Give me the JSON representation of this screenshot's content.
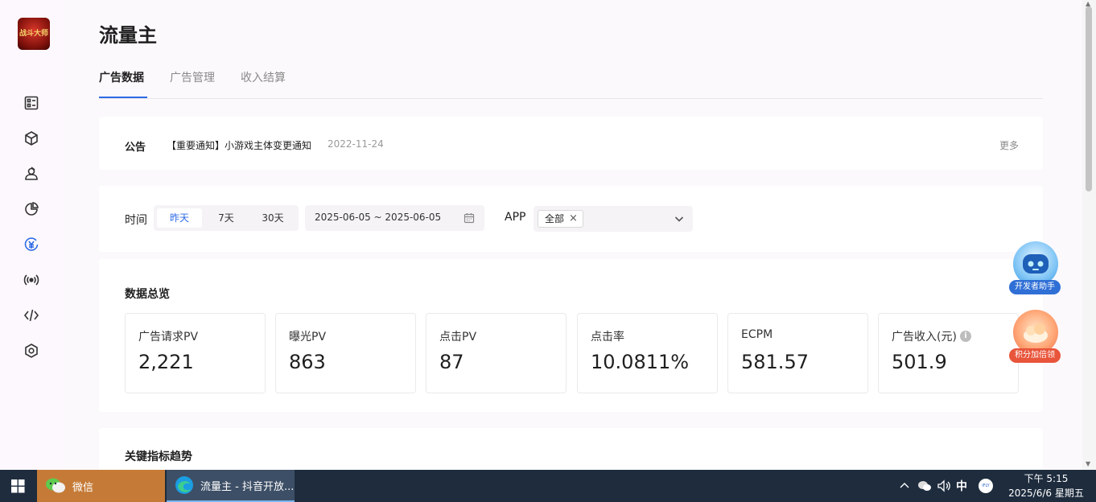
{
  "app": {
    "logo_text": "战斗大师"
  },
  "sidebar": {
    "items": [
      {
        "icon": "dashboard-icon"
      },
      {
        "icon": "cube-icon"
      },
      {
        "icon": "user-group-icon"
      },
      {
        "icon": "pie-chart-icon"
      },
      {
        "icon": "yuan-icon"
      },
      {
        "icon": "broadcast-icon"
      },
      {
        "icon": "code-icon"
      },
      {
        "icon": "settings-hexagon-icon"
      }
    ],
    "active_index": 4
  },
  "header": {
    "title": "流量主",
    "tabs": [
      {
        "label": "广告数据",
        "active": true
      },
      {
        "label": "广告管理",
        "active": false
      },
      {
        "label": "收入结算",
        "active": false
      }
    ]
  },
  "notice": {
    "label": "公告",
    "text": "【重要通知】小游戏主体变更通知",
    "date": "2022-11-24",
    "more": "更多"
  },
  "filter": {
    "time_label": "时间",
    "ranges": [
      "昨天",
      "7天",
      "30天"
    ],
    "active_range": "昨天",
    "date_range": "2025-06-05 ~ 2025-06-05",
    "app_label": "APP",
    "app_tag": "全部",
    "app_tag_close": "×"
  },
  "overview": {
    "title": "数据总览",
    "metrics": [
      {
        "label": "广告请求PV",
        "value": "2,221"
      },
      {
        "label": "曝光PV",
        "value": "863"
      },
      {
        "label": "点击PV",
        "value": "87"
      },
      {
        "label": "点击率",
        "value": "10.0811%"
      },
      {
        "label": "ECPM",
        "value": "581.57"
      },
      {
        "label": "广告收入(元)",
        "value": "501.9",
        "info": "i"
      }
    ]
  },
  "trend": {
    "title": "关键指标趋势"
  },
  "floating": {
    "assistant_label": "开发者助手",
    "points_label": "积分加倍领"
  },
  "taskbar": {
    "apps": [
      {
        "label": "微信"
      },
      {
        "label": "流量主 - 抖音开放..."
      }
    ],
    "tray": {
      "ime": "中",
      "ime_badge": "iFLY"
    },
    "clock": {
      "time": "下午 5:15",
      "date": "2025/6/6 星期五"
    }
  },
  "colors": {
    "accent": "#2e6be6",
    "page_bg": "#fcf9fc",
    "taskbar_bg": "#1e2c3e",
    "wechat_task_bg": "#c57b37"
  }
}
